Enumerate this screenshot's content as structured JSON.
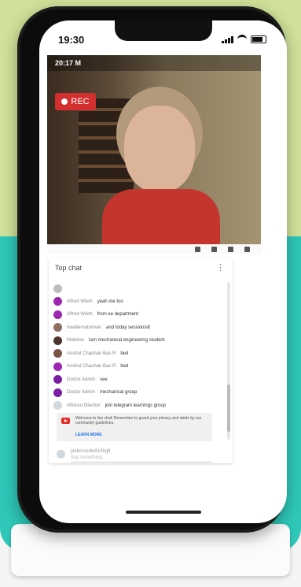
{
  "status_bar": {
    "time": "19:30"
  },
  "video": {
    "overlay_time": "20:17 M",
    "rec_label": "REC"
  },
  "chat": {
    "header": "Top chat",
    "more": "⋮",
    "messages": [
      {
        "user": "",
        "text": "",
        "avatar_color": "#bdbdbd"
      },
      {
        "user": "Alfred Wieth",
        "text": "yeah me too",
        "avatar_color": "#9c27b0"
      },
      {
        "user": "Alfred Wieth",
        "text": "from ee department",
        "avatar_color": "#9c27b0"
      },
      {
        "user": "nwalternatuniver",
        "text": "and today sessionsitt",
        "avatar_color": "#8d6e63"
      },
      {
        "user": "Mskikoe",
        "text": "Iam mechanical engineering student",
        "avatar_color": "#4e342e"
      },
      {
        "user": "Anshul Chauhan Bas R",
        "text": "bed",
        "avatar_color": "#795548"
      },
      {
        "user": "Anshul Chauhan Bas R",
        "text": "bed",
        "avatar_color": "#9c27b0"
      },
      {
        "user": "Doctor Admin",
        "text": "see",
        "avatar_color": "#7b1fa2"
      },
      {
        "user": "Doctor Admin",
        "text": "mechanical group",
        "avatar_color": "#7b1fa2"
      },
      {
        "user": "Alfonso Glecher",
        "text": "join telegram learnings group",
        "avatar_color": "#cfd8dc"
      }
    ],
    "banner": {
      "text": "Welcome to live chat! Remember to guard your privacy and abide by our community guidelines.",
      "link": "LEARN MORE"
    },
    "input": {
      "name": "jackmoodle8106g8",
      "placeholder": "Say something..."
    }
  },
  "colors": {
    "rec": "#d32f2f",
    "accent": "#1a73e8",
    "bg_green": "#cfe19a",
    "bg_teal": "#2ec7b8"
  }
}
